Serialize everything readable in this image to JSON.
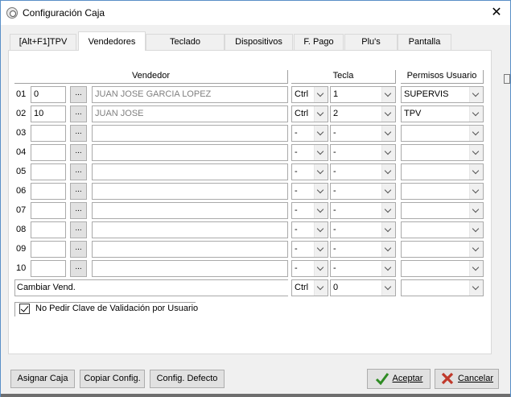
{
  "window": {
    "title": "Configuración Caja",
    "close_symbol": "✕"
  },
  "tabs": [
    {
      "label": "[Alt+F1]TPV"
    },
    {
      "label": "Vendedores"
    },
    {
      "label": "Teclado"
    },
    {
      "label": "Dispositivos"
    },
    {
      "label": "F. Pago"
    },
    {
      "label": "Plu's"
    },
    {
      "label": "Pantalla"
    }
  ],
  "active_tab": "Vendedores",
  "headers": {
    "vendedor": "Vendedor",
    "tecla": "Tecla",
    "permisos": "Permisos Usuario"
  },
  "rows": [
    {
      "num": "01",
      "code": "0",
      "dots": "...",
      "name": "JUAN JOSE GARCIA LOPEZ",
      "mod": "Ctrl",
      "key": "1",
      "perm": "SUPERVIS"
    },
    {
      "num": "02",
      "code": "10",
      "dots": "...",
      "name": "JUAN JOSE",
      "mod": "Ctrl",
      "key": "2",
      "perm": "TPV"
    },
    {
      "num": "03",
      "code": "",
      "dots": "...",
      "name": "",
      "mod": "-",
      "key": "-",
      "perm": ""
    },
    {
      "num": "04",
      "code": "",
      "dots": "...",
      "name": "",
      "mod": "-",
      "key": "-",
      "perm": ""
    },
    {
      "num": "05",
      "code": "",
      "dots": "...",
      "name": "",
      "mod": "-",
      "key": "-",
      "perm": ""
    },
    {
      "num": "06",
      "code": "",
      "dots": "...",
      "name": "",
      "mod": "-",
      "key": "-",
      "perm": ""
    },
    {
      "num": "07",
      "code": "",
      "dots": "...",
      "name": "",
      "mod": "-",
      "key": "-",
      "perm": ""
    },
    {
      "num": "08",
      "code": "",
      "dots": "...",
      "name": "",
      "mod": "-",
      "key": "-",
      "perm": ""
    },
    {
      "num": "09",
      "code": "",
      "dots": "...",
      "name": "",
      "mod": "-",
      "key": "-",
      "perm": ""
    },
    {
      "num": "10",
      "code": "",
      "dots": "...",
      "name": "",
      "mod": "-",
      "key": "-",
      "perm": ""
    }
  ],
  "cambiar": {
    "label": "Cambiar Vend.",
    "mod": "Ctrl",
    "key": "0",
    "perm": ""
  },
  "checkbox": {
    "label": "No Pedir Clave de Validación por Usuario",
    "checked": true
  },
  "buttons": {
    "asignar": "Asignar Caja",
    "copiar": "Copiar Config.",
    "defecto": "Config. Defecto",
    "aceptar": "Aceptar",
    "cancelar": "Cancelar"
  },
  "colors": {
    "accept_check": "#2e8b23",
    "cancel_x": "#c0392b",
    "window_border": "#5a8fc7"
  },
  "icons": {
    "app": "gear-icon",
    "accept": "checkmark-icon",
    "cancel": "cross-icon"
  }
}
